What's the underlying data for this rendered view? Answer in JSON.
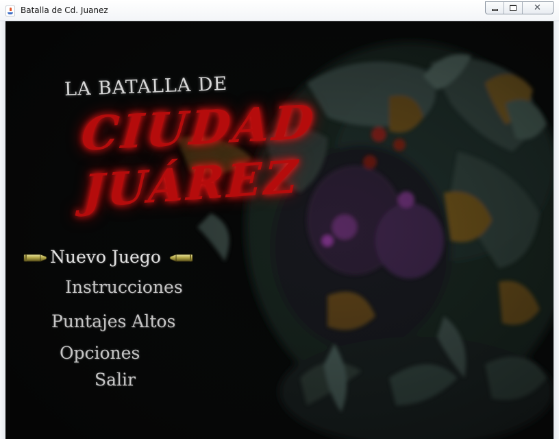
{
  "window": {
    "title": "Batalla de Cd. Juanez",
    "controls": [
      "minimize-icon",
      "maximize-icon",
      "close-icon"
    ],
    "close_glyph": "✕"
  },
  "logo": {
    "line_top": "LA BATALLA DE",
    "line_1": "CIUDAD",
    "line_2": "JUÁREZ",
    "accent_color": "#b50c0c"
  },
  "menu": {
    "selected_index": 0,
    "selector_icon": "bullet-icon",
    "items": [
      {
        "label": "Nuevo Juego"
      },
      {
        "label": "Instrucciones"
      },
      {
        "label": "Puntajes Altos"
      },
      {
        "label": "Opciones"
      },
      {
        "label": "Salir"
      }
    ]
  },
  "background": {
    "subject": "monster-artwork"
  }
}
